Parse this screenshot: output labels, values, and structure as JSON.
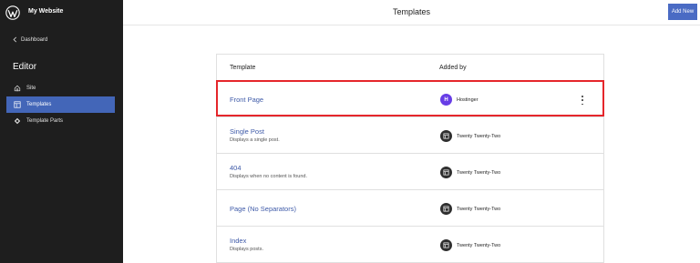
{
  "sidebar": {
    "site_name": "My Website",
    "back_label": "Dashboard",
    "title": "Editor",
    "items": [
      {
        "label": "Site",
        "icon": "home-icon",
        "active": false
      },
      {
        "label": "Templates",
        "icon": "templates-icon",
        "active": true
      },
      {
        "label": "Template Parts",
        "icon": "template-parts-icon",
        "active": false
      }
    ]
  },
  "header": {
    "title": "Templates",
    "add_new_label": "Add New"
  },
  "table": {
    "columns": [
      "Template",
      "Added by"
    ],
    "rows": [
      {
        "title": "Front Page",
        "description": "",
        "author": "Hostinger",
        "author_icon": "avatar-h",
        "avatar_letter": "H",
        "highlighted": true
      },
      {
        "title": "Single Post",
        "description": "Displays a single post.",
        "author": "Twenty Twenty-Two",
        "author_icon": "layout-icon"
      },
      {
        "title": "404",
        "description": "Displays when no content is found.",
        "author": "Twenty Twenty-Two",
        "author_icon": "layout-icon"
      },
      {
        "title": "Page (No Separators)",
        "description": "",
        "author": "Twenty Twenty-Two",
        "author_icon": "layout-icon"
      },
      {
        "title": "Index",
        "description": "Displays posts.",
        "author": "Twenty Twenty-Two",
        "author_icon": "layout-icon"
      }
    ]
  },
  "colors": {
    "sidebar_bg": "#1e1e1e",
    "accent": "#4366b8",
    "link": "#3e5aa8",
    "highlight_border": "#e5262b",
    "hostinger_purple": "#673de6"
  }
}
